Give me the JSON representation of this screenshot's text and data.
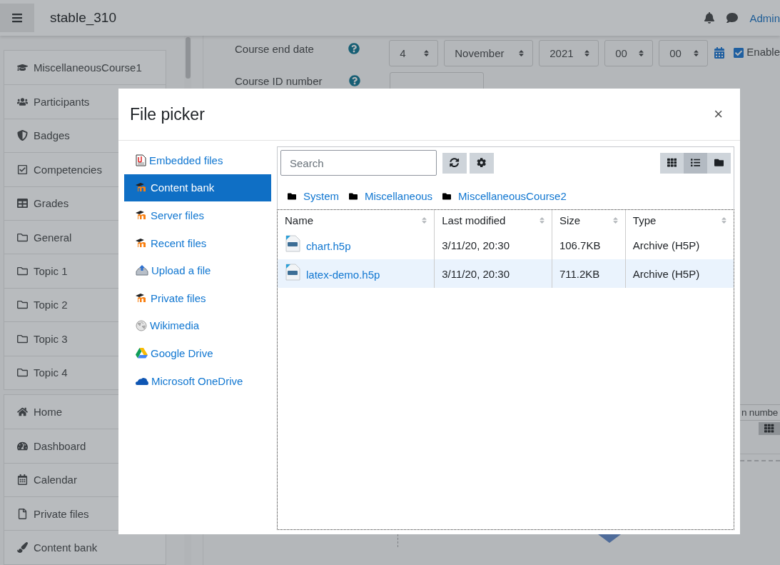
{
  "header": {
    "site_name": "stable_310",
    "user": "Admin"
  },
  "sidebar": {
    "groups": [
      {
        "items": [
          "MiscellaneousCourse1",
          "Participants",
          "Badges",
          "Competencies",
          "Grades",
          "General",
          "Topic 1",
          "Topic 2",
          "Topic 3",
          "Topic 4"
        ]
      },
      {
        "items": [
          "Home",
          "Dashboard",
          "Calendar",
          "Private files",
          "Content bank"
        ]
      }
    ]
  },
  "form": {
    "end_date": {
      "label": "Course end date",
      "day": "4",
      "month": "November",
      "year": "2021",
      "hour": "00",
      "minute": "00",
      "enable": {
        "label": "Enable",
        "checked": true
      }
    },
    "id_number": {
      "label": "Course ID number"
    },
    "partial_label": "n numbe"
  },
  "file_picker": {
    "title": "File picker",
    "close": "×",
    "repositories": [
      {
        "label": "Embedded files",
        "selected": false
      },
      {
        "label": "Content bank",
        "selected": true
      },
      {
        "label": "Server files",
        "selected": false
      },
      {
        "label": "Recent files",
        "selected": false
      },
      {
        "label": "Upload a file",
        "selected": false
      },
      {
        "label": "Private files",
        "selected": false
      },
      {
        "label": "Wikimedia",
        "selected": false
      },
      {
        "label": "Google Drive",
        "selected": false
      },
      {
        "label": "Microsoft OneDrive",
        "selected": false
      }
    ],
    "search": {
      "placeholder": "Search"
    },
    "views": [
      {
        "selected": false
      },
      {
        "selected": true
      },
      {
        "selected": false
      }
    ],
    "breadcrumb": [
      "System",
      "Miscellaneous",
      "MiscellaneousCourse2"
    ],
    "table": {
      "columns": [
        "Name",
        "Last modified",
        "Size",
        "Type"
      ],
      "rows": [
        {
          "name": "chart.h5p",
          "modified": "3/11/20, 20:30",
          "size": "106.7KB",
          "type": "Archive (H5P)",
          "selected": false
        },
        {
          "name": "latex-demo.h5p",
          "modified": "3/11/20, 20:30",
          "size": "711.2KB",
          "type": "Archive (H5P)",
          "selected": true
        }
      ]
    }
  }
}
